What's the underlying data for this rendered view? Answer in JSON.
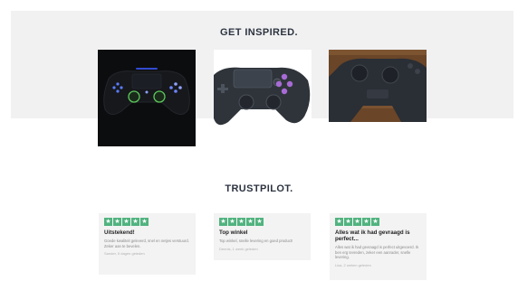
{
  "inspired": {
    "title": "GET INSPIRED."
  },
  "gallery": [
    {
      "name": "controller-dark-lights"
    },
    {
      "name": "controller-white-background"
    },
    {
      "name": "controller-on-wood"
    }
  ],
  "trustpilot": {
    "title": "TRUSTPILOT.",
    "star_glyph": "★",
    "star_color": "#51b37f",
    "reviews": [
      {
        "rating": 5,
        "title": "Uitstekend!",
        "body": "Goede kwaliteit geleverd, snel en netjes verstuurd. Zeker aan te bevelen.",
        "meta": "Sander, 5 dagen geleden"
      },
      {
        "rating": 5,
        "title": "Top winkel",
        "body": "Top winkel, snelle levering en goed product!",
        "meta": "Dennis, 1 week geleden"
      },
      {
        "rating": 5,
        "title": "Alles wat ik had gevraagd is perfect...",
        "body": "Alles wat ik had gevraagd is perfect uitgevoerd. Ik ben erg tevreden, zeker een aanrader, snelle levering.",
        "meta": "Lisa, 2 weken geleden"
      }
    ]
  }
}
